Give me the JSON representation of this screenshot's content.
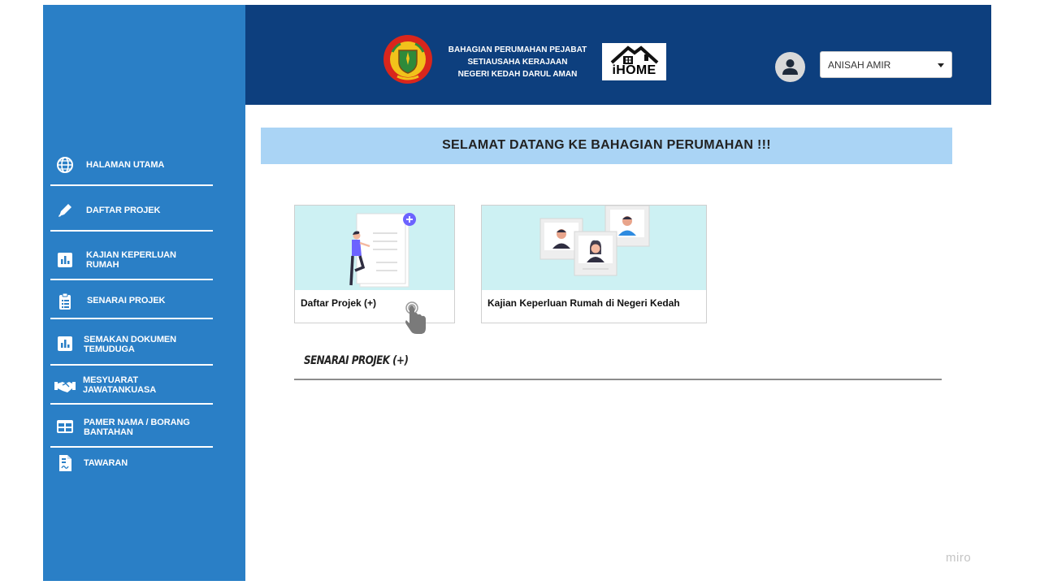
{
  "header": {
    "org_name_line1": "BAHAGIAN PERUMAHAN PEJABAT",
    "org_name_line2": "SETIAUSAHA KERAJAAN",
    "org_name_line3": "NEGERI KEDAH DARUL AMAN",
    "app_logo_text": "iHOME",
    "user": {
      "name": "ANISAH AMIR",
      "icon": "user-avatar-icon"
    }
  },
  "sidebar": {
    "items": [
      {
        "line1": "HALAMAN UTAMA",
        "line2": "",
        "icon": "globe-icon"
      },
      {
        "line1": "DAFTAR PROJEK",
        "line2": "",
        "icon": "pen-icon"
      },
      {
        "line1": "KAJIAN KEPERLUAN",
        "line2": "RUMAH",
        "icon": "bar-chart-icon"
      },
      {
        "line1": "SENARAI PROJEK",
        "line2": "",
        "icon": "clipboard-list-icon"
      },
      {
        "line1": "SEMAKAN DOKUMEN",
        "line2": "TEMUDUGA",
        "icon": "bar-chart-icon"
      },
      {
        "line1": "MESYUARAT",
        "line2": "JAWATANKUASA",
        "icon": "handshake-icon"
      },
      {
        "line1": "PAMER NAMA / BORANG",
        "line2": "BANTAHAN",
        "icon": "table-icon"
      },
      {
        "line1": "TAWARAN",
        "line2": "",
        "icon": "document-icon"
      }
    ]
  },
  "main": {
    "welcome": "SELAMAT DATANG KE BAHAGIAN PERUMAHAN !!!",
    "cards": [
      {
        "label": "Daftar Projek  (+)"
      },
      {
        "label": "Kajian Keperluan Rumah di Negeri Kedah"
      }
    ],
    "section_title": "SENARAI PROJEK (+)"
  },
  "watermark": "miro",
  "colors": {
    "sidebar": "#2a7fc6",
    "topbar": "#0d3f7e",
    "banner": "#aad4f5",
    "card_image": "#cdf1f3",
    "accent_purple": "#6c63ff"
  }
}
